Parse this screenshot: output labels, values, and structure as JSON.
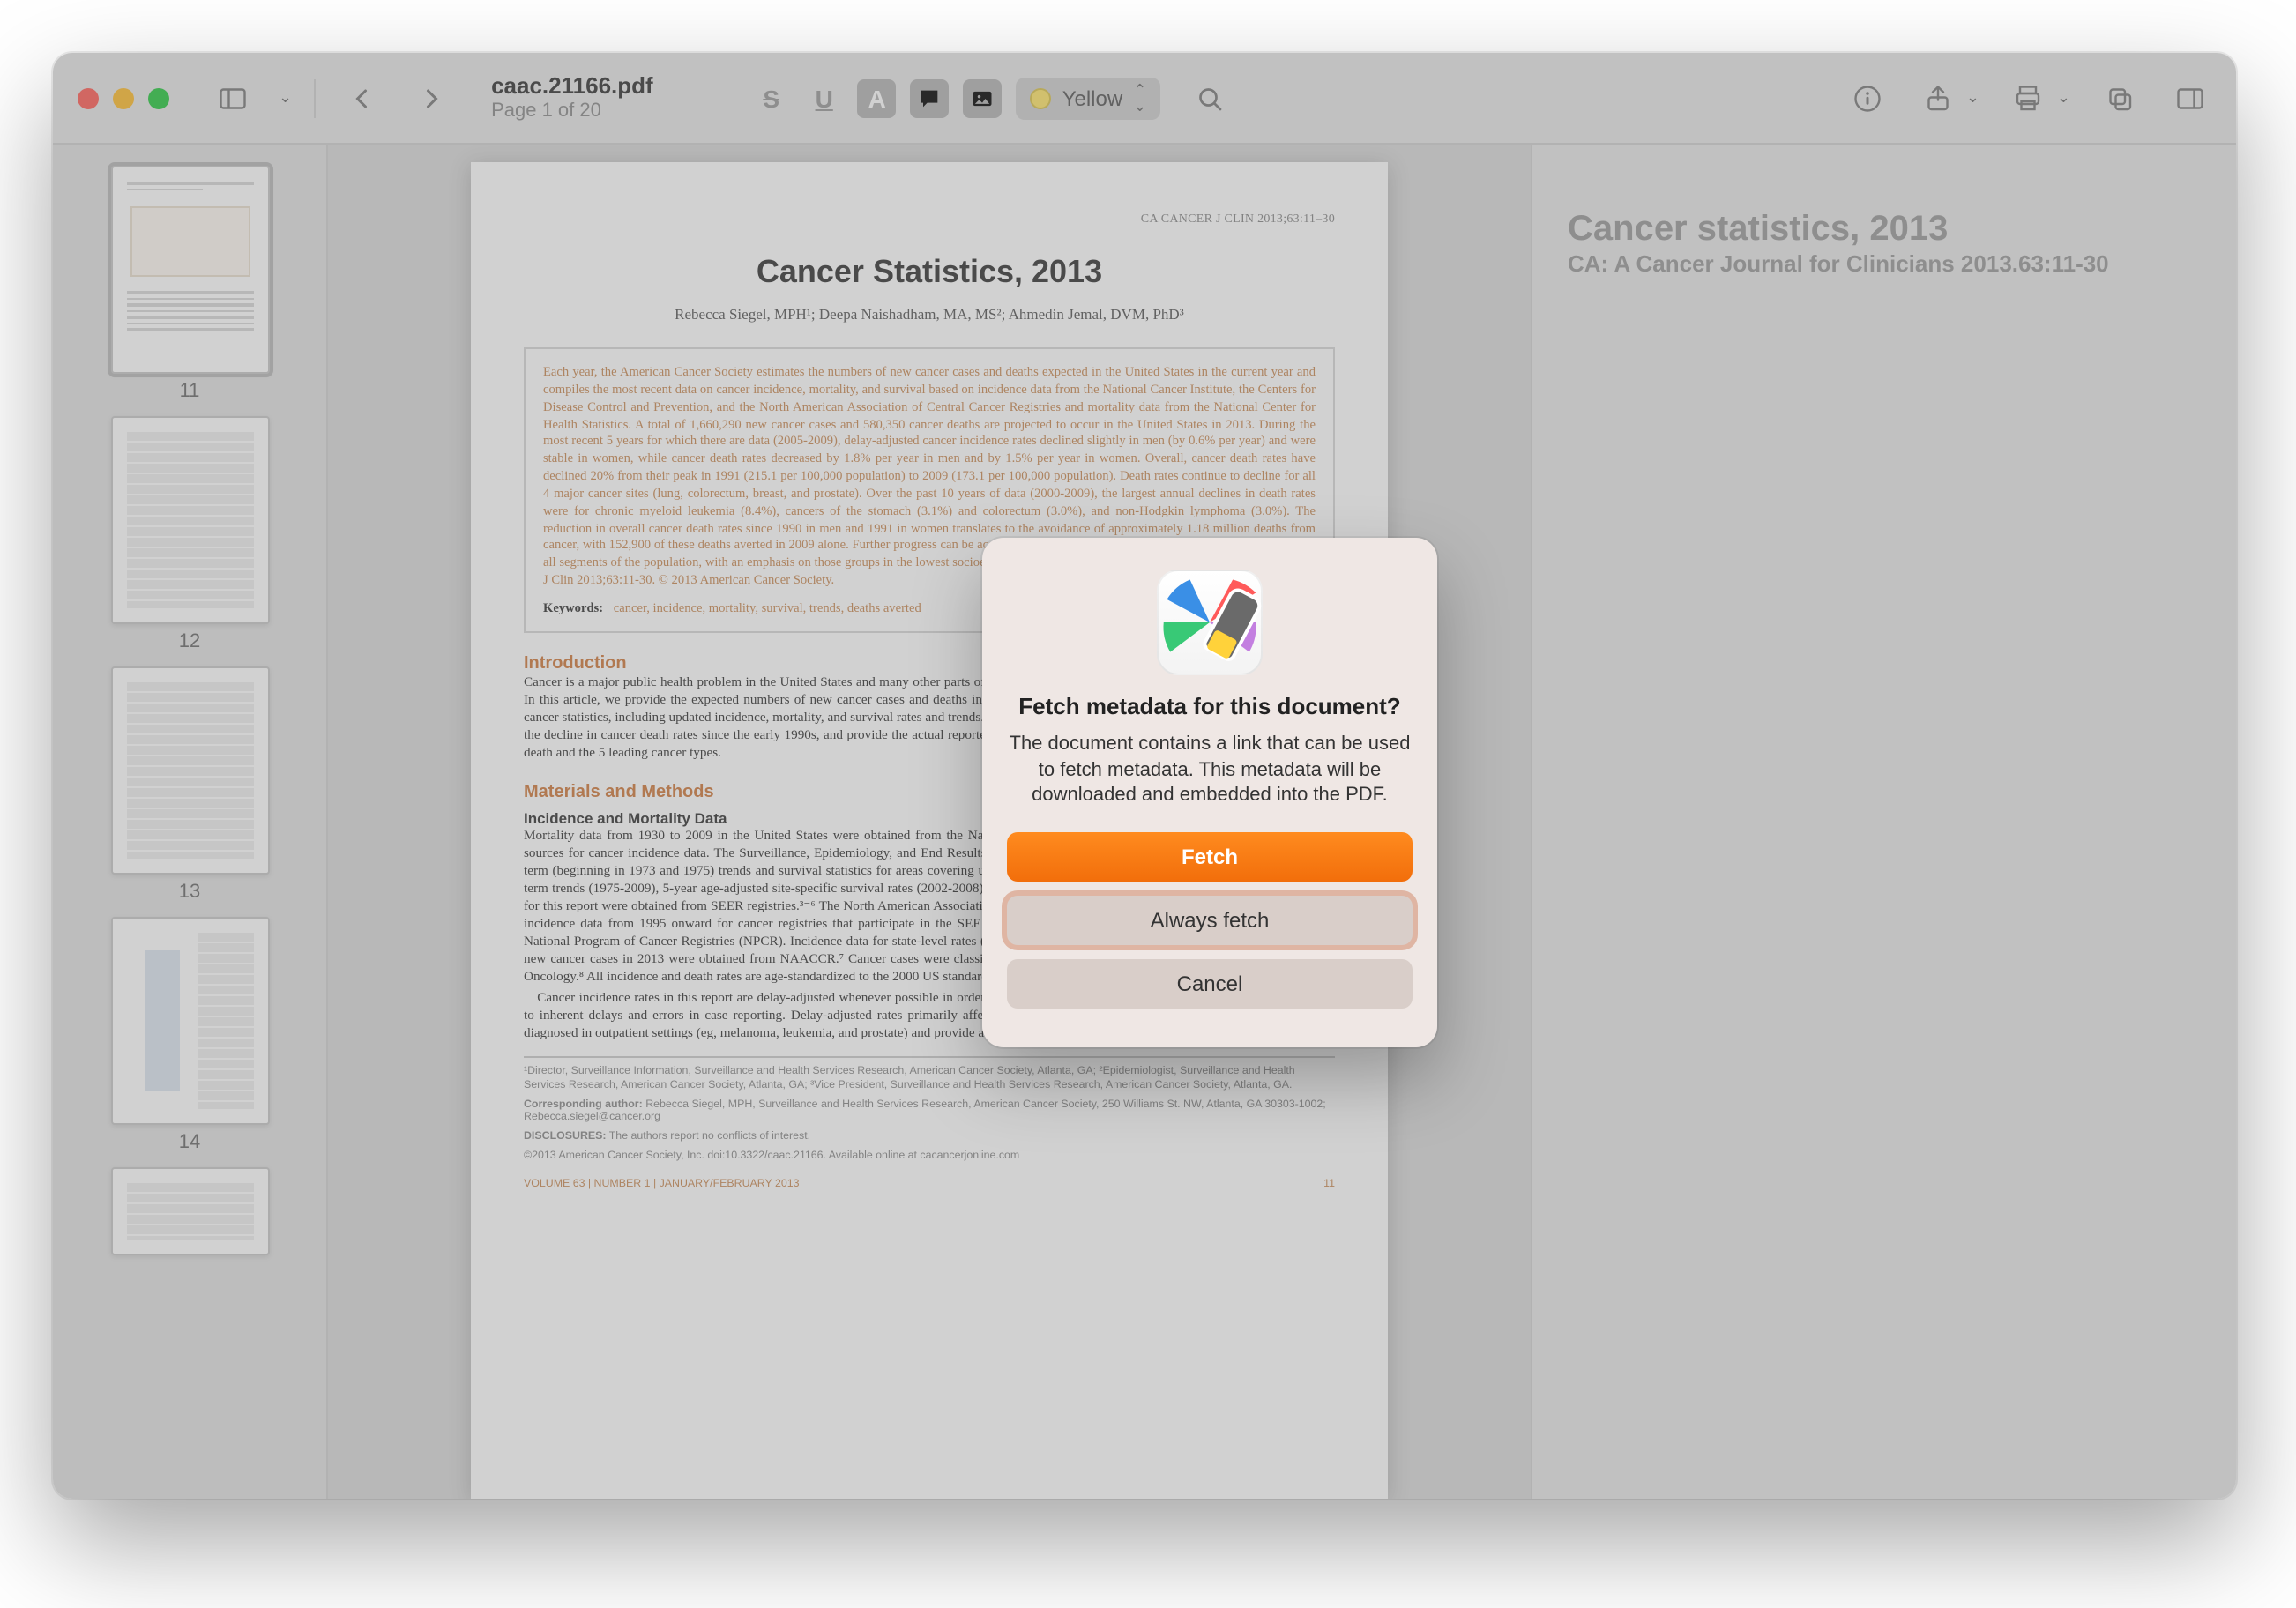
{
  "window": {
    "filename": "caac.21166.pdf",
    "page_indicator": "Page 1 of 20"
  },
  "toolbar": {
    "annotate_S": "S",
    "annotate_U": "U",
    "annotate_A": "A",
    "highlight_color_label": "Yellow"
  },
  "thumbnails": [
    "11",
    "12",
    "13",
    "14",
    ""
  ],
  "page": {
    "running_header": "CA CANCER J CLIN 2013;63:11–30",
    "title": "Cancer Statistics, 2013",
    "authors": "Rebecca Siegel, MPH¹; Deepa Naishadham, MA, MS²; Ahmedin Jemal, DVM, PhD³",
    "abstract": "Each year, the American Cancer Society estimates the numbers of new cancer cases and deaths expected in the United States in the current year and compiles the most recent data on cancer incidence, mortality, and survival based on incidence data from the National Cancer Institute, the Centers for Disease Control and Prevention, and the North American Association of Central Cancer Registries and mortality data from the National Center for Health Statistics. A total of 1,660,290 new cancer cases and 580,350 cancer deaths are projected to occur in the United States in 2013. During the most recent 5 years for which there are data (2005-2009), delay-adjusted cancer incidence rates declined slightly in men (by 0.6% per year) and were stable in women, while cancer death rates decreased by 1.8% per year in men and by 1.5% per year in women. Overall, cancer death rates have declined 20% from their peak in 1991 (215.1 per 100,000 population) to 2009 (173.1 per 100,000 population). Death rates continue to decline for all 4 major cancer sites (lung, colorectum, breast, and prostate). Over the past 10 years of data (2000-2009), the largest annual declines in death rates were for chronic myeloid leukemia (8.4%), cancers of the stomach (3.1%) and colorectum (3.0%), and non-Hodgkin lymphoma (3.0%). The reduction in overall cancer death rates since 1990 in men and 1991 in women translates to the avoidance of approximately 1.18 million deaths from cancer, with 152,900 of these deaths averted in 2009 alone. Further progress can be accelerated by applying existing cancer control knowledge across all segments of the population, with an emphasis on those groups in the lowest socioeconomic bracket and other underserved populations. CA Cancer J Clin 2013;63:11-30. © 2013 American Cancer Society.",
    "keywords_label": "Keywords:",
    "keywords": "cancer, incidence, mortality, survival, trends, deaths averted",
    "intro_h": "Introduction",
    "intro": "Cancer is a major public health problem in the United States and many other parts of the world. One in 4 deaths in the United States is due to cancer. In this article, we provide the expected numbers of new cancer cases and deaths in 2013 nationally and by state, as well as an overview of current cancer statistics, including updated incidence, mortality, and survival rates and trends. We also estimate the total number of deaths averted as a result of the decline in cancer death rates since the early 1990s, and provide the actual reported numbers of deaths in 2009 by age for the 10 leading causes of death and the 5 leading cancer types.",
    "methods_h": "Materials and Methods",
    "methods_sub": "Incidence and Mortality Data",
    "methods_body": "Mortality data from 1930 to 2009 in the United States were obtained from the National Center for Health Statistics (NCHS).¹,² There are several sources for cancer incidence data. The Surveillance, Epidemiology, and End Results (SEER) program of the National Cancer Institute reports long-term (beginning in 1973 and 1975) trends and survival statistics for areas covering up to 26% of the US population. Cancer incidence rates for long-term trends (1975-2009), 5-year age-adjusted site-specific survival rates (2002-2008), and estimations of the lifetime probability of developing cancer for this report were obtained from SEER registries.³⁻⁶ The North American Association of Central Cancer Registries (NAACCR) has compiled cancer incidence data from 1995 onward for cancer registries that participate in the SEER program or the Centers for Disease Control and Prevention's National Program of Cancer Registries (NPCR). Incidence data for state-level rates (2005-2009), trends by race/ethnicity (2000-2009), and estimated new cancer cases in 2013 were obtained from NAACCR.⁷ Cancer cases were classified according to the International Classification of Diseases for Oncology.⁸ All incidence and death rates are age-standardized to the 2000 US standard population and expressed per 100,000 persons.",
    "methods_body2": "Cancer incidence rates in this report are delay-adjusted whenever possible in order to account for anticipated future corrections to registry data due to inherent delays and errors in case reporting. Delay-adjusted rates primarily affect the most recent years of data for cancers that are frequently diagnosed in outpatient settings (eg, melanoma, leukemia, and prostate) and provide a more",
    "affil": "¹Director, Surveillance Information, Surveillance and Health Services Research, American Cancer Society, Atlanta, GA; ²Epidemiologist, Surveillance and Health Services Research, American Cancer Society, Atlanta, GA; ³Vice President, Surveillance and Health Services Research, American Cancer Society, Atlanta, GA.",
    "corresponding_label": "Corresponding author:",
    "corresponding": "Rebecca Siegel, MPH, Surveillance and Health Services Research, American Cancer Society, 250 Williams St. NW, Atlanta, GA 30303-1002; Rebecca.siegel@cancer.org",
    "disclosures_label": "DISCLOSURES:",
    "disclosures": "The authors report no conflicts of interest.",
    "copyright": "©2013 American Cancer Society, Inc. doi:10.3322/caac.21166. Available online at cacancerjonline.com",
    "footer_left": "VOLUME 63 | NUMBER 1 | JANUARY/FEBRUARY 2013",
    "footer_right": "11"
  },
  "sidebar_meta": {
    "title": "Cancer statistics, 2013",
    "journal": "CA: A Cancer Journal for Clinicians 2013.63:11-30"
  },
  "dialog": {
    "heading": "Fetch metadata for this document?",
    "body": "The document contains a link that can be used to fetch metadata. This metadata will be downloaded and embedded into the PDF.",
    "primary": "Fetch",
    "secondary": "Always fetch",
    "cancel": "Cancel"
  }
}
